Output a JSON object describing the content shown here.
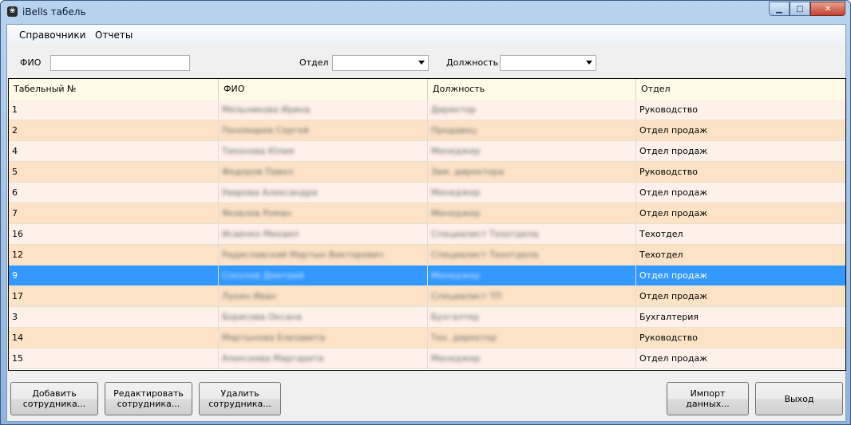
{
  "window": {
    "title": "iBells табель"
  },
  "menu": [
    "Справочники",
    "Отчеты"
  ],
  "filters": {
    "fio_label": "ФИО",
    "fio_value": "",
    "department_label": "Отдел",
    "department_value": "",
    "position_label": "Должность",
    "position_value": ""
  },
  "table": {
    "columns": [
      "Табельный №",
      "ФИО",
      "Должность",
      "Отдел"
    ],
    "rows": [
      [
        "1",
        "Мельникова Ирина",
        "Директор",
        "Руководство"
      ],
      [
        "2",
        "Пономарев Сергей",
        "Продавец",
        "Отдел продаж"
      ],
      [
        "4",
        "Тихонова Юлия",
        "Менеджер",
        "Отдел продаж"
      ],
      [
        "5",
        "Федоров Павел",
        "Зам. директора",
        "Руководство"
      ],
      [
        "6",
        "Уварова Александра",
        "Менеджер",
        "Отдел продаж"
      ],
      [
        "7",
        "Яковлев Роман",
        "Менеджер",
        "Отдел продаж"
      ],
      [
        "16",
        "Исаенко Михаил",
        "Специалист Техотдела",
        "Техотдел"
      ],
      [
        "12",
        "Радиславский Мартын Викторович",
        "Специалист Техотдела",
        "Техотдел"
      ],
      [
        "9",
        "Соколов Дмитрий",
        "Менеджер",
        "Отдел продаж"
      ],
      [
        "17",
        "Лукин Иван",
        "Специалист ТП",
        "Отдел продаж"
      ],
      [
        "3",
        "Борисова Оксана",
        "Бухгалтер",
        "Бухгалтерия"
      ],
      [
        "14",
        "Мартынова Елизавета",
        "Тех. директор",
        "Руководство"
      ],
      [
        "15",
        "Алексеева Маргарита",
        "Менеджер",
        "Отдел продаж"
      ]
    ],
    "selected_index": 8
  },
  "buttons": {
    "add": "Добавить\nсотрудника...",
    "edit": "Редактировать\nсотрудника...",
    "delete": "Удалить\nсотрудника...",
    "import": "Импорт данных...",
    "exit": "Выход"
  }
}
